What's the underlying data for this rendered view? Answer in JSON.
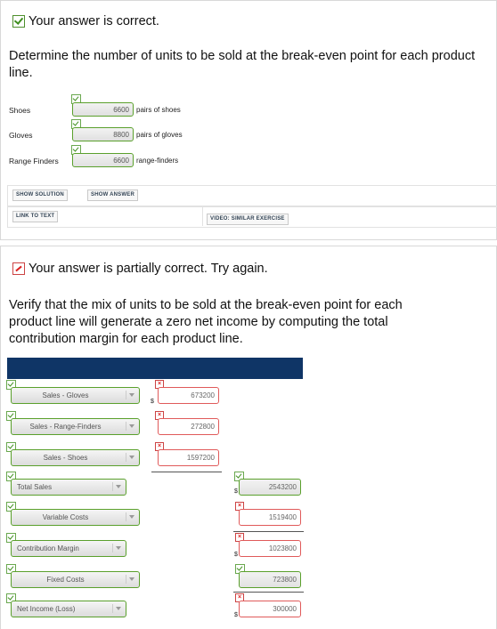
{
  "part1": {
    "status": "Your answer is correct.",
    "question": "Determine the number of units to be sold at the break-even point for each product line.",
    "rows": [
      {
        "label": "Shoes",
        "value": "6600",
        "unit": "pairs of shoes"
      },
      {
        "label": "Gloves",
        "value": "8800",
        "unit": "pairs of gloves"
      },
      {
        "label": "Range Finders",
        "value": "6600",
        "unit": "range-finders"
      }
    ],
    "buttons": {
      "show_solution": "SHOW SOLUTION",
      "show_answer": "SHOW ANSWER",
      "link_to_text": "LINK TO TEXT",
      "video": "VIDEO: SIMILAR EXERCISE"
    }
  },
  "part2": {
    "status": "Your answer is partially correct.  Try again.",
    "question_lines": [
      "Verify that the mix of units to be sold at the break-even point for each",
      "product line will generate a zero net income by computing the total",
      "contribution margin for each product line."
    ],
    "currency": "$",
    "rows": [
      {
        "label": "Sales - Gloves",
        "value": "673200"
      },
      {
        "label": "Sales - Range-Finders",
        "value": "272800"
      },
      {
        "label": "Sales - Shoes",
        "value": "1597200"
      },
      {
        "label": "Total Sales",
        "value": "2543200"
      },
      {
        "label": "Variable Costs",
        "value": "1519400"
      },
      {
        "label": "Contribution Margin",
        "value": "1023800"
      },
      {
        "label": "Fixed Costs",
        "value": "723800"
      },
      {
        "label": "Net Income (Loss)",
        "value": "300000"
      }
    ]
  }
}
